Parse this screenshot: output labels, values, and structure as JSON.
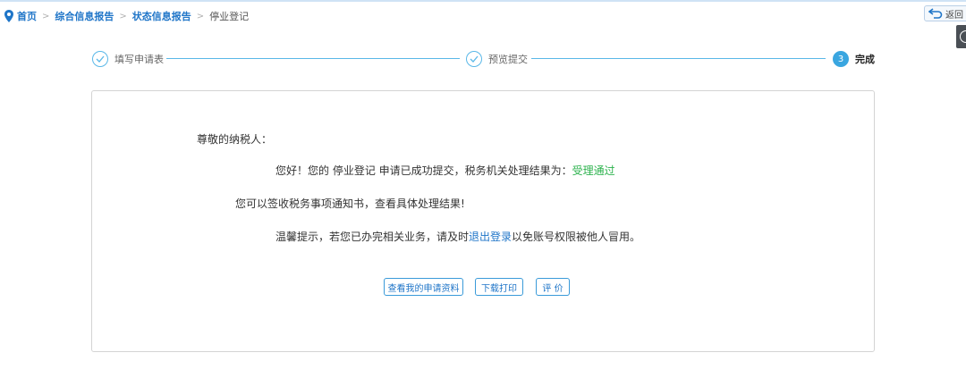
{
  "breadcrumb": {
    "home": "首页",
    "level1": "综合信息报告",
    "level2": "状态信息报告",
    "current": "停业登记",
    "separator": ">"
  },
  "header": {
    "back_label": "返回"
  },
  "steps": [
    {
      "label": "填写申请表",
      "status": "done"
    },
    {
      "label": "预览提交",
      "status": "done"
    },
    {
      "number": "3",
      "label": "完成",
      "status": "active"
    }
  ],
  "result": {
    "salutation": "尊敬的纳税人：",
    "line1_prefix": "您好！您的 停业登记 申请已成功提交，税务机关处理结果为：",
    "line1_status": "受理通过",
    "line2": "您可以签收税务事项通知书，查看具体处理结果!",
    "line3_prefix": "温馨提示，若您已办完相关业务，请及时",
    "line3_link": "退出登录",
    "line3_suffix": "以免账号权限被他人冒用。"
  },
  "actions": {
    "view_label": "查看我的申请资料",
    "download_label": "下载打印",
    "rate_label": "评 价"
  },
  "colors": {
    "accent": "#3aa6e0",
    "link": "#1f75c8",
    "success": "#2bb24c"
  }
}
